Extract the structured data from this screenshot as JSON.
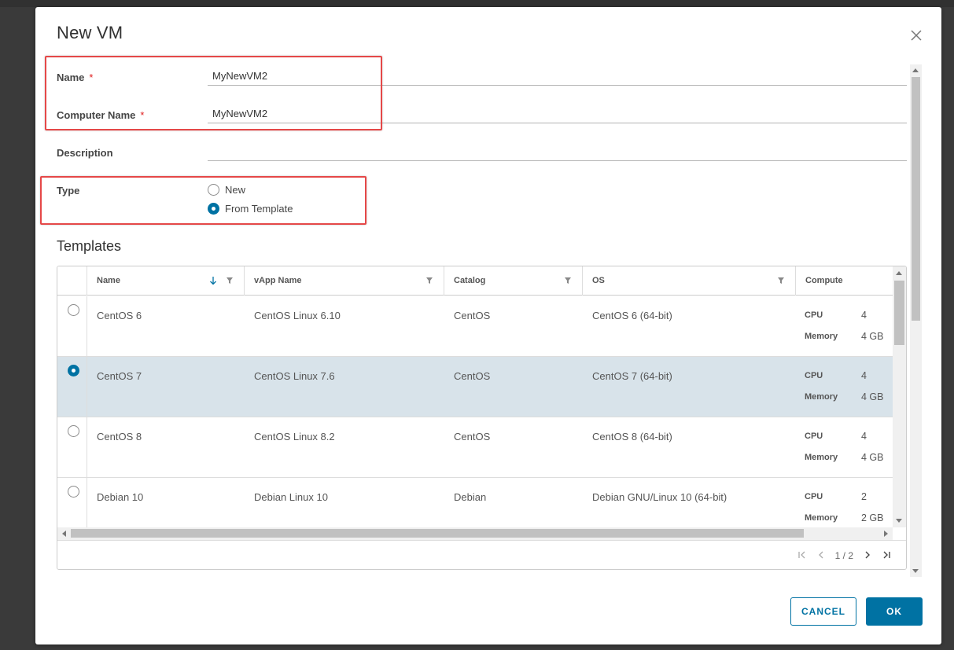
{
  "dialog": {
    "title": "New VM"
  },
  "form": {
    "name_label": "Name",
    "name_value": "MyNewVM2",
    "computer_name_label": "Computer Name",
    "computer_name_value": "MyNewVM2",
    "required_mark": "*",
    "description_label": "Description",
    "description_value": "",
    "type_label": "Type",
    "type_options": [
      {
        "label": "New",
        "checked": false
      },
      {
        "label": "From Template",
        "checked": true
      }
    ]
  },
  "templates": {
    "title": "Templates",
    "columns": [
      "Name",
      "vApp Name",
      "Catalog",
      "OS",
      "Compute"
    ],
    "sort_icon": "sort-descending-icon",
    "filter_icon": "filter-icon",
    "compute_keys": [
      "CPU",
      "Memory"
    ],
    "rows": [
      {
        "name": "CentOS 6",
        "vapp": "CentOS Linux 6.10",
        "catalog": "CentOS",
        "os": "CentOS 6 (64-bit)",
        "cpu": "4",
        "memory": "4 GB",
        "selected": false
      },
      {
        "name": "CentOS 7",
        "vapp": "CentOS Linux 7.6",
        "catalog": "CentOS",
        "os": "CentOS 7 (64-bit)",
        "cpu": "4",
        "memory": "4 GB",
        "selected": true
      },
      {
        "name": "CentOS 8",
        "vapp": "CentOS Linux 8.2",
        "catalog": "CentOS",
        "os": "CentOS 8 (64-bit)",
        "cpu": "4",
        "memory": "4 GB",
        "selected": false
      },
      {
        "name": "Debian 10",
        "vapp": "Debian Linux 10",
        "catalog": "Debian",
        "os": "Debian GNU/Linux 10 (64-bit)",
        "cpu": "2",
        "memory": "2 GB",
        "selected": false
      }
    ],
    "pagination": {
      "text": "1 / 2",
      "first": "first-page-icon",
      "prev": "previous-page-icon",
      "next": "next-page-icon",
      "last": "last-page-icon"
    }
  },
  "buttons": {
    "cancel": "CANCEL",
    "ok": "OK"
  },
  "colors": {
    "accent": "#0072a3",
    "selected_row": "#d8e3ea",
    "highlight_box": "#e54848",
    "required": "#e02020"
  }
}
